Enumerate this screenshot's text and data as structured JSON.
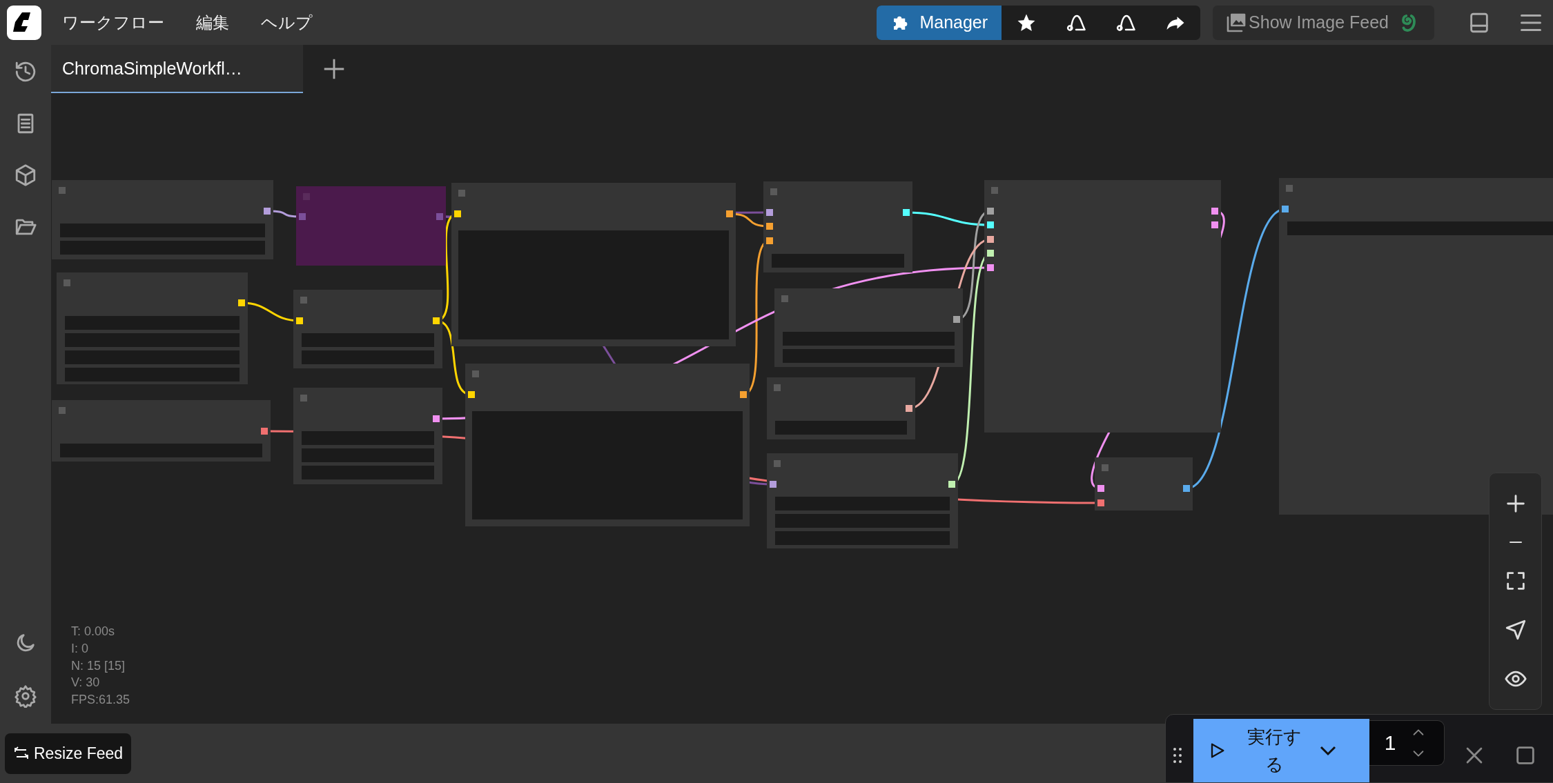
{
  "menu": [
    {
      "label": "ワークフロー"
    },
    {
      "label": "編集"
    },
    {
      "label": "ヘルプ"
    }
  ],
  "toolbar": {
    "manager_button": "Manager",
    "image_feed_button": "Show Image Feed"
  },
  "tabs": [
    {
      "label": "ChromaSimpleWorkfl…",
      "selected": true
    }
  ],
  "stats": [
    "T: 0.00s",
    "I: 0",
    "N: 15 [15]",
    "V: 30",
    "FPS:61.35"
  ],
  "resize_feed_button": "Resize Feed",
  "run_bar": {
    "run_button": "実行する",
    "batch_count": "1"
  }
}
